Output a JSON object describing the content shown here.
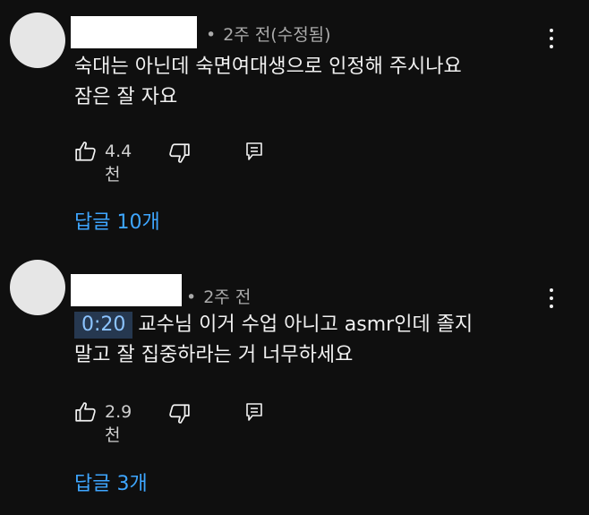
{
  "comments": [
    {
      "meta": "2주 전(수정됨)",
      "lines": [
        "숙대는 아닌데 숙면여대생으로 인정해 주시나요",
        "잠은 잘 자요"
      ],
      "likes": "4.4천",
      "replies": "답글 10개"
    },
    {
      "meta": "2주 전",
      "timestamp": "0:20",
      "lines": [
        "교수님 이거 수업 아니고 asmr인데 졸지",
        "말고 잘 집중하라는 거 너무하세요"
      ],
      "likes": "2.9천",
      "replies": "답글 3개"
    }
  ],
  "icons": {
    "like": "thumbs-up-icon",
    "dislike": "thumbs-down-icon",
    "reply": "reply-icon",
    "more": "more-vertical-icon"
  },
  "colors": {
    "background": "#0f0f0f",
    "link": "#3ea6ff",
    "timestamp_bg": "#263850"
  }
}
